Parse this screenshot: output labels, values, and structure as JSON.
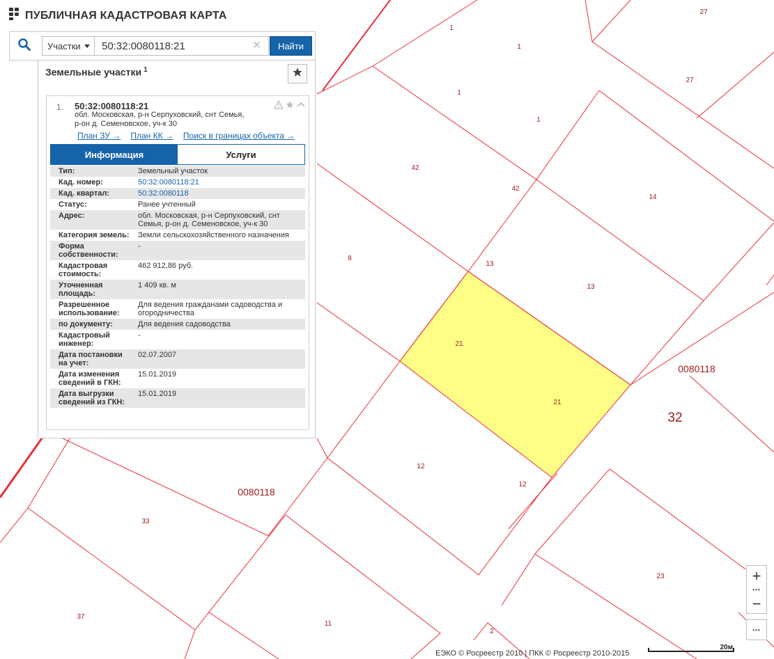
{
  "header": {
    "title": "ПУБЛИЧНАЯ КАДАСТРОВАЯ КАРТА"
  },
  "search": {
    "type_selected": "Участки",
    "query": "50:32:0080118:21",
    "find_label": "Найти"
  },
  "panel": {
    "title": "Земельные участки",
    "count": "1",
    "result": {
      "number": "1.",
      "cad_number": "50:32:0080118:21",
      "address_lines": [
        "обл. Московская, р-н Серпуховский, снт Семья,",
        "р-он д. Семеновское, уч-к 30"
      ],
      "links": [
        "План ЗУ →",
        "План КК →",
        "Поиск в границах объекта →"
      ],
      "tabs": [
        "Информация",
        "Услуги"
      ],
      "rows": [
        {
          "k": "Тип:",
          "v": "Земельный участок"
        },
        {
          "k": "Кад. номер:",
          "v": "50:32:0080118:21",
          "link": true
        },
        {
          "k": "Кад. квартал:",
          "v": "50:32:0080118",
          "link": true
        },
        {
          "k": "Статус:",
          "v": "Ранее учтенный"
        },
        {
          "k": "Адрес:",
          "v": "обл. Московская, р-н Серпуховский, снт Семья, р-он д. Семеновское, уч-к 30"
        },
        {
          "k": "Категория земель:",
          "v": "Земли сельскохозяйственного назначения"
        },
        {
          "k": "Форма собственности:",
          "v": "-"
        },
        {
          "k": "Кадастровая стоимость:",
          "v": "462 912,86 руб."
        },
        {
          "k": "Уточненная площадь:",
          "v": "1 409 кв. м"
        },
        {
          "k": "Разрешенное использование:",
          "v": "Для ведения гражданами садоводства и огородничества"
        },
        {
          "k": "по документу:",
          "v": "Для ведения садоводства"
        },
        {
          "k": "Кадастровый инженер:",
          "v": "-"
        },
        {
          "k": "Дата постановки на учет:",
          "v": "02.07.2007"
        },
        {
          "k": "Дата изменения сведений в ГКН:",
          "v": "15.01.2019"
        },
        {
          "k": "Дата выгрузки сведений из ГКН:",
          "v": "15.01.2019"
        }
      ]
    }
  },
  "map": {
    "parcel_labels": [
      "1",
      "1",
      "1",
      "1",
      "27",
      "27",
      "42",
      "42",
      "14",
      "8",
      "13",
      "13",
      "21",
      "21",
      "12",
      "12",
      "33",
      "37",
      "11",
      "2",
      "23"
    ],
    "block_labels": [
      "0080118",
      "0080118"
    ],
    "district_label": "32",
    "highlight_color": "#fefe86",
    "boundary_color": "#e8303a"
  },
  "footer": {
    "copyright": "ЕЭКО © Росреестр 2010 | ПКК © Росреестр 2010-2015",
    "scale_label": "20м"
  },
  "controls": {
    "zoom_in": "+",
    "zoom_out": "−",
    "dots": "•••"
  }
}
